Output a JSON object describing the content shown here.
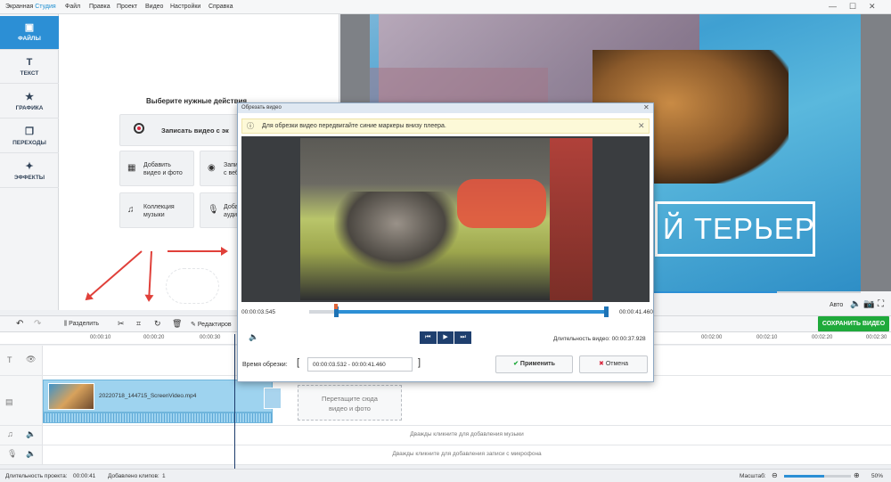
{
  "app": {
    "title_part1": "Экранная ",
    "title_part2": "Студия"
  },
  "menu": [
    "Файл",
    "Правка",
    "Проект",
    "Видео",
    "Настройки",
    "Справка"
  ],
  "window_controls": {
    "minimize": "—",
    "maximize": "☐",
    "close": "✕"
  },
  "left_tabs": [
    {
      "label": "ФАЙЛЫ",
      "icon": "files-icon",
      "active": true
    },
    {
      "label": "ТЕКСТ",
      "icon": "text-icon",
      "active": false
    },
    {
      "label": "ГРАФИКА",
      "icon": "star-icon",
      "active": false
    },
    {
      "label": "ПЕРЕХОДЫ",
      "icon": "transitions-icon",
      "active": false
    },
    {
      "label": "ЭФФЕКТЫ",
      "icon": "wand-icon",
      "active": false
    }
  ],
  "files_panel": {
    "heading": "Выберите нужные действия",
    "record_label": "Записать видео с эк",
    "add_video_line1": "Добавить",
    "add_video_line2": "видео и фото",
    "capture_line1": "Запи",
    "capture_line2": "с веб",
    "music_line1": "Коллекция",
    "music_line2": "музыки",
    "audio_line1": "Доба",
    "audio_line2": "ауди"
  },
  "preview": {
    "overlay_text": "Й ТЕРЬЕР",
    "auto_label": "Авто",
    "progress": 0.83
  },
  "toolbar": {
    "undo": "↶",
    "redo": "↷",
    "split_label": "Разделить",
    "edit_label": "Редактиров",
    "save_label": "СОХРАНИТЬ ВИДЕО"
  },
  "ruler_ticks": [
    "00:00:10",
    "00:00:20",
    "00:00:30",
    "00:02:00",
    "00:02:10",
    "00:02:20",
    "00:02:30"
  ],
  "timeline": {
    "clip_name": "20220718_144715_ScreenVideo.mp4",
    "drop_line1": "Перетащите сюда",
    "drop_line2": "видео и фото",
    "music_hint": "Дважды кликните для добавления музыки",
    "mic_hint": "Дважды кликните для добавления записи с микрофона"
  },
  "status": {
    "duration_label": "Длительность проекта:",
    "duration_value": "00:00:41",
    "clips_label": "Добавлено клипов:",
    "clips_value": "1",
    "zoom_label": "Масштаб:",
    "zoom_value": "50%",
    "zoom_level": 0.6
  },
  "trim_dialog": {
    "title": "Обрезать видео",
    "info": "Для обрезки видео передвигайте синие маркеры внизу плеера.",
    "start_time": "00:00:03.545",
    "end_time": "00:00:41.460",
    "duration_label": "Длительность видео:",
    "duration_value": "00:00:37.928",
    "trim_label": "Время обрезки:",
    "range_value": "00:00:03.532 - 00:00:41.460",
    "apply_label": "Применить",
    "cancel_label": "Отмена",
    "range_start_fraction": 0.09,
    "range_end_fraction": 1.0
  },
  "colors": {
    "accent": "#2c8fd5",
    "save": "#1faa3b",
    "arrow": "#e0403a",
    "track_clip": "#9ed3ef"
  }
}
